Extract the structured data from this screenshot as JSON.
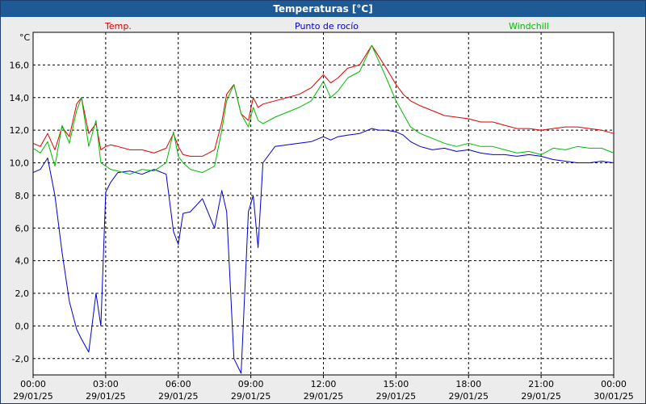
{
  "window": {
    "title": "Temperaturas [°C]"
  },
  "chart_data": {
    "type": "line",
    "title": "Temperaturas [°C]",
    "ylabel": "°C",
    "ylim": [
      -3.0,
      18.0
    ],
    "xlim": [
      0,
      24
    ],
    "grid": true,
    "legend_placement": "top",
    "y_ticks": [
      "16,0",
      "14,0",
      "12,0",
      "10,0",
      "8,0",
      "6,0",
      "4,0",
      "2,0",
      "0,0",
      "-2,0"
    ],
    "y_tick_values": [
      16,
      14,
      12,
      10,
      8,
      6,
      4,
      2,
      0,
      -2
    ],
    "x_ticks": [
      {
        "time": "00:00",
        "date": "29/01/25",
        "hour": 0
      },
      {
        "time": "03:00",
        "date": "29/01/25",
        "hour": 3
      },
      {
        "time": "06:00",
        "date": "29/01/25",
        "hour": 6
      },
      {
        "time": "09:00",
        "date": "29/01/25",
        "hour": 9
      },
      {
        "time": "12:00",
        "date": "29/01/25",
        "hour": 12
      },
      {
        "time": "15:00",
        "date": "29/01/25",
        "hour": 15
      },
      {
        "time": "18:00",
        "date": "29/01/25",
        "hour": 18
      },
      {
        "time": "21:00",
        "date": "29/01/25",
        "hour": 21
      },
      {
        "time": "00:00",
        "date": "30/01/25",
        "hour": 24
      }
    ],
    "series": [
      {
        "name": "Temp.",
        "color": "#dd0000",
        "x": [
          0,
          0.3,
          0.6,
          0.9,
          1.2,
          1.5,
          1.8,
          2.0,
          2.3,
          2.6,
          2.8,
          3.0,
          3.2,
          3.5,
          4.0,
          4.5,
          5.0,
          5.5,
          5.8,
          6.0,
          6.2,
          6.5,
          7.0,
          7.5,
          7.8,
          8.0,
          8.3,
          8.6,
          8.9,
          9.1,
          9.3,
          9.5,
          10.0,
          10.5,
          11.0,
          11.5,
          12.0,
          12.3,
          12.6,
          13.0,
          13.5,
          14.0,
          14.3,
          14.6,
          15.0,
          15.3,
          15.6,
          16.0,
          16.5,
          17.0,
          17.5,
          18.0,
          18.5,
          19.0,
          19.5,
          20.0,
          20.5,
          21.0,
          21.5,
          22.0,
          22.5,
          23.0,
          23.5,
          24.0
        ],
        "y": [
          11.2,
          11.0,
          11.8,
          10.8,
          12.2,
          11.6,
          13.6,
          14.0,
          11.8,
          12.4,
          10.8,
          11.0,
          11.1,
          11.0,
          10.8,
          10.8,
          10.6,
          10.9,
          11.8,
          11.0,
          10.5,
          10.4,
          10.4,
          10.8,
          12.5,
          14.2,
          14.8,
          13.0,
          12.6,
          14.0,
          13.4,
          13.6,
          13.8,
          14.0,
          14.2,
          14.6,
          15.4,
          14.9,
          15.2,
          15.8,
          16.0,
          17.2,
          16.5,
          15.8,
          14.8,
          14.2,
          13.8,
          13.5,
          13.2,
          12.9,
          12.8,
          12.7,
          12.5,
          12.5,
          12.3,
          12.1,
          12.1,
          12.0,
          12.1,
          12.2,
          12.2,
          12.1,
          12.0,
          11.8
        ]
      },
      {
        "name": "Punto de rocío",
        "color": "#0000cc",
        "x": [
          0,
          0.3,
          0.6,
          0.9,
          1.2,
          1.5,
          1.8,
          2.0,
          2.3,
          2.6,
          2.8,
          3.0,
          3.2,
          3.5,
          4.0,
          4.5,
          5.0,
          5.5,
          5.8,
          6.0,
          6.2,
          6.5,
          7.0,
          7.5,
          7.8,
          8.0,
          8.3,
          8.6,
          8.9,
          9.1,
          9.3,
          9.5,
          10.0,
          10.5,
          11.0,
          11.5,
          12.0,
          12.3,
          12.6,
          13.0,
          13.5,
          14.0,
          14.3,
          14.6,
          15.0,
          15.3,
          15.6,
          16.0,
          16.5,
          17.0,
          17.5,
          18.0,
          18.5,
          19.0,
          19.5,
          20.0,
          20.5,
          21.0,
          21.5,
          22.0,
          22.5,
          23.0,
          23.5,
          24.0
        ],
        "y": [
          9.4,
          9.6,
          10.3,
          8.0,
          4.5,
          1.5,
          -0.2,
          -0.8,
          -1.6,
          2.0,
          0.0,
          8.2,
          8.8,
          9.4,
          9.5,
          9.3,
          9.6,
          9.3,
          5.8,
          5.0,
          6.9,
          7.0,
          7.8,
          6.0,
          8.3,
          7.0,
          -2.0,
          -2.9,
          7.0,
          8.0,
          4.8,
          10.0,
          11.0,
          11.1,
          11.2,
          11.3,
          11.6,
          11.4,
          11.6,
          11.7,
          11.8,
          12.1,
          12.0,
          12.0,
          11.9,
          11.7,
          11.3,
          11.0,
          10.8,
          10.9,
          10.7,
          10.8,
          10.6,
          10.5,
          10.5,
          10.4,
          10.5,
          10.4,
          10.2,
          10.1,
          10.0,
          10.0,
          10.1,
          10.0
        ]
      },
      {
        "name": "Windchill",
        "color": "#00bb00",
        "x": [
          0,
          0.3,
          0.6,
          0.9,
          1.2,
          1.5,
          1.8,
          2.0,
          2.3,
          2.6,
          2.8,
          3.0,
          3.2,
          3.5,
          4.0,
          4.5,
          5.0,
          5.5,
          5.8,
          6.0,
          6.2,
          6.5,
          7.0,
          7.5,
          7.8,
          8.0,
          8.3,
          8.6,
          8.9,
          9.1,
          9.3,
          9.5,
          10.0,
          10.5,
          11.0,
          11.5,
          12.0,
          12.3,
          12.6,
          13.0,
          13.5,
          14.0,
          14.3,
          14.6,
          15.0,
          15.3,
          15.6,
          16.0,
          16.5,
          17.0,
          17.5,
          18.0,
          18.5,
          19.0,
          19.5,
          20.0,
          20.5,
          21.0,
          21.5,
          22.0,
          22.5,
          23.0,
          23.5,
          24.0
        ],
        "y": [
          10.9,
          10.6,
          11.3,
          9.8,
          12.3,
          11.2,
          13.2,
          14.0,
          11.0,
          12.6,
          10.0,
          9.8,
          9.6,
          9.5,
          9.3,
          9.6,
          9.5,
          10.0,
          11.9,
          10.4,
          10.0,
          9.6,
          9.4,
          9.8,
          12.0,
          13.8,
          14.8,
          13.0,
          12.2,
          13.4,
          12.6,
          12.4,
          12.8,
          13.1,
          13.4,
          13.8,
          15.0,
          14.0,
          14.4,
          15.2,
          15.6,
          17.2,
          16.2,
          15.2,
          13.8,
          13.0,
          12.2,
          11.8,
          11.5,
          11.2,
          11.0,
          11.2,
          11.0,
          11.0,
          10.8,
          10.6,
          10.7,
          10.5,
          10.9,
          10.8,
          11.0,
          10.9,
          10.9,
          10.6
        ]
      }
    ]
  }
}
